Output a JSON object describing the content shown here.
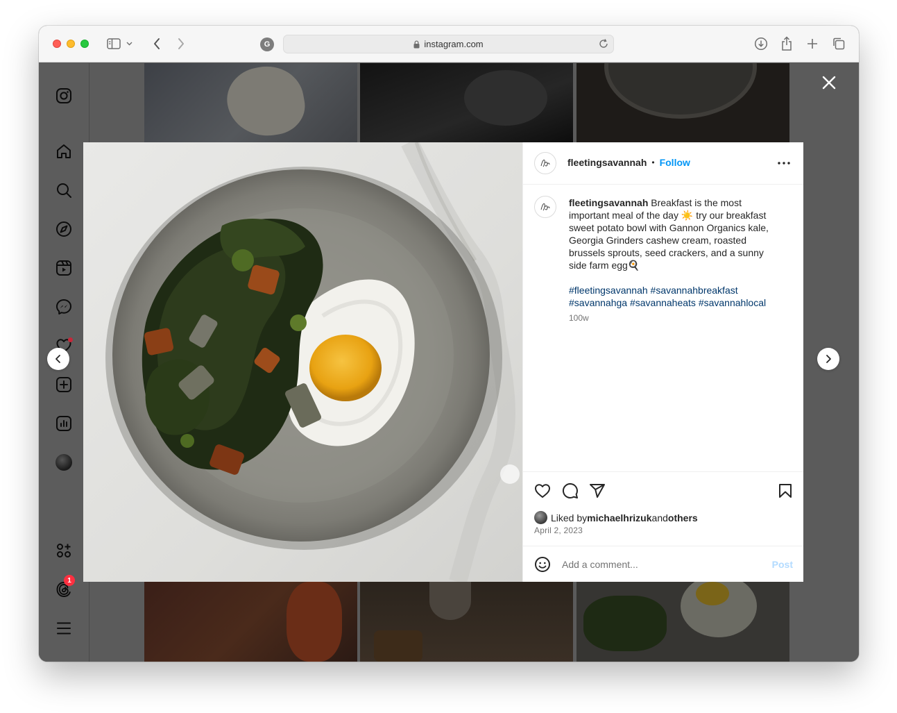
{
  "browser": {
    "url": "instagram.com",
    "site_badge": "G"
  },
  "sidebar": {
    "items": [
      {
        "name": "instagram-logo-icon"
      },
      {
        "name": "home-icon"
      },
      {
        "name": "search-icon"
      },
      {
        "name": "explore-icon"
      },
      {
        "name": "reels-icon"
      },
      {
        "name": "messenger-icon"
      },
      {
        "name": "notifications-heart-icon"
      },
      {
        "name": "create-icon"
      },
      {
        "name": "dashboard-icon"
      },
      {
        "name": "profile-avatar"
      },
      {
        "name": "more-apps-icon"
      },
      {
        "name": "threads-icon"
      },
      {
        "name": "menu-icon"
      }
    ],
    "threads_badge": "1"
  },
  "post": {
    "username": "fleetingsavannah",
    "separator": "•",
    "follow_label": "Follow",
    "caption_username": "fleetingsavannah",
    "caption_part1": " Breakfast is the most important meal of the day ",
    "sun_emoji": "☀️",
    "caption_part2": " try our breakfast sweet potato bowl with Gannon Organics kale, Georgia Grinders cashew cream, roasted brussels sprouts, seed crackers, and a sunny side farm egg",
    "egg_emoji": "🍳",
    "hashtags": "#fleetingsavannah #savannahbreakfast #savannahga #savannaheats #savannahlocal",
    "time_ago": "100w",
    "liked_prefix": "Liked by ",
    "liked_user": "michaelhrizuk",
    "liked_middle": " and ",
    "liked_others": "others",
    "date": "April 2, 2023",
    "comment_placeholder": "Add a comment...",
    "post_label": "Post"
  },
  "colors": {
    "follow": "#0095f6",
    "hashtag": "#00376b",
    "post_disabled": "#b3dbff",
    "badge": "#ff3040"
  }
}
